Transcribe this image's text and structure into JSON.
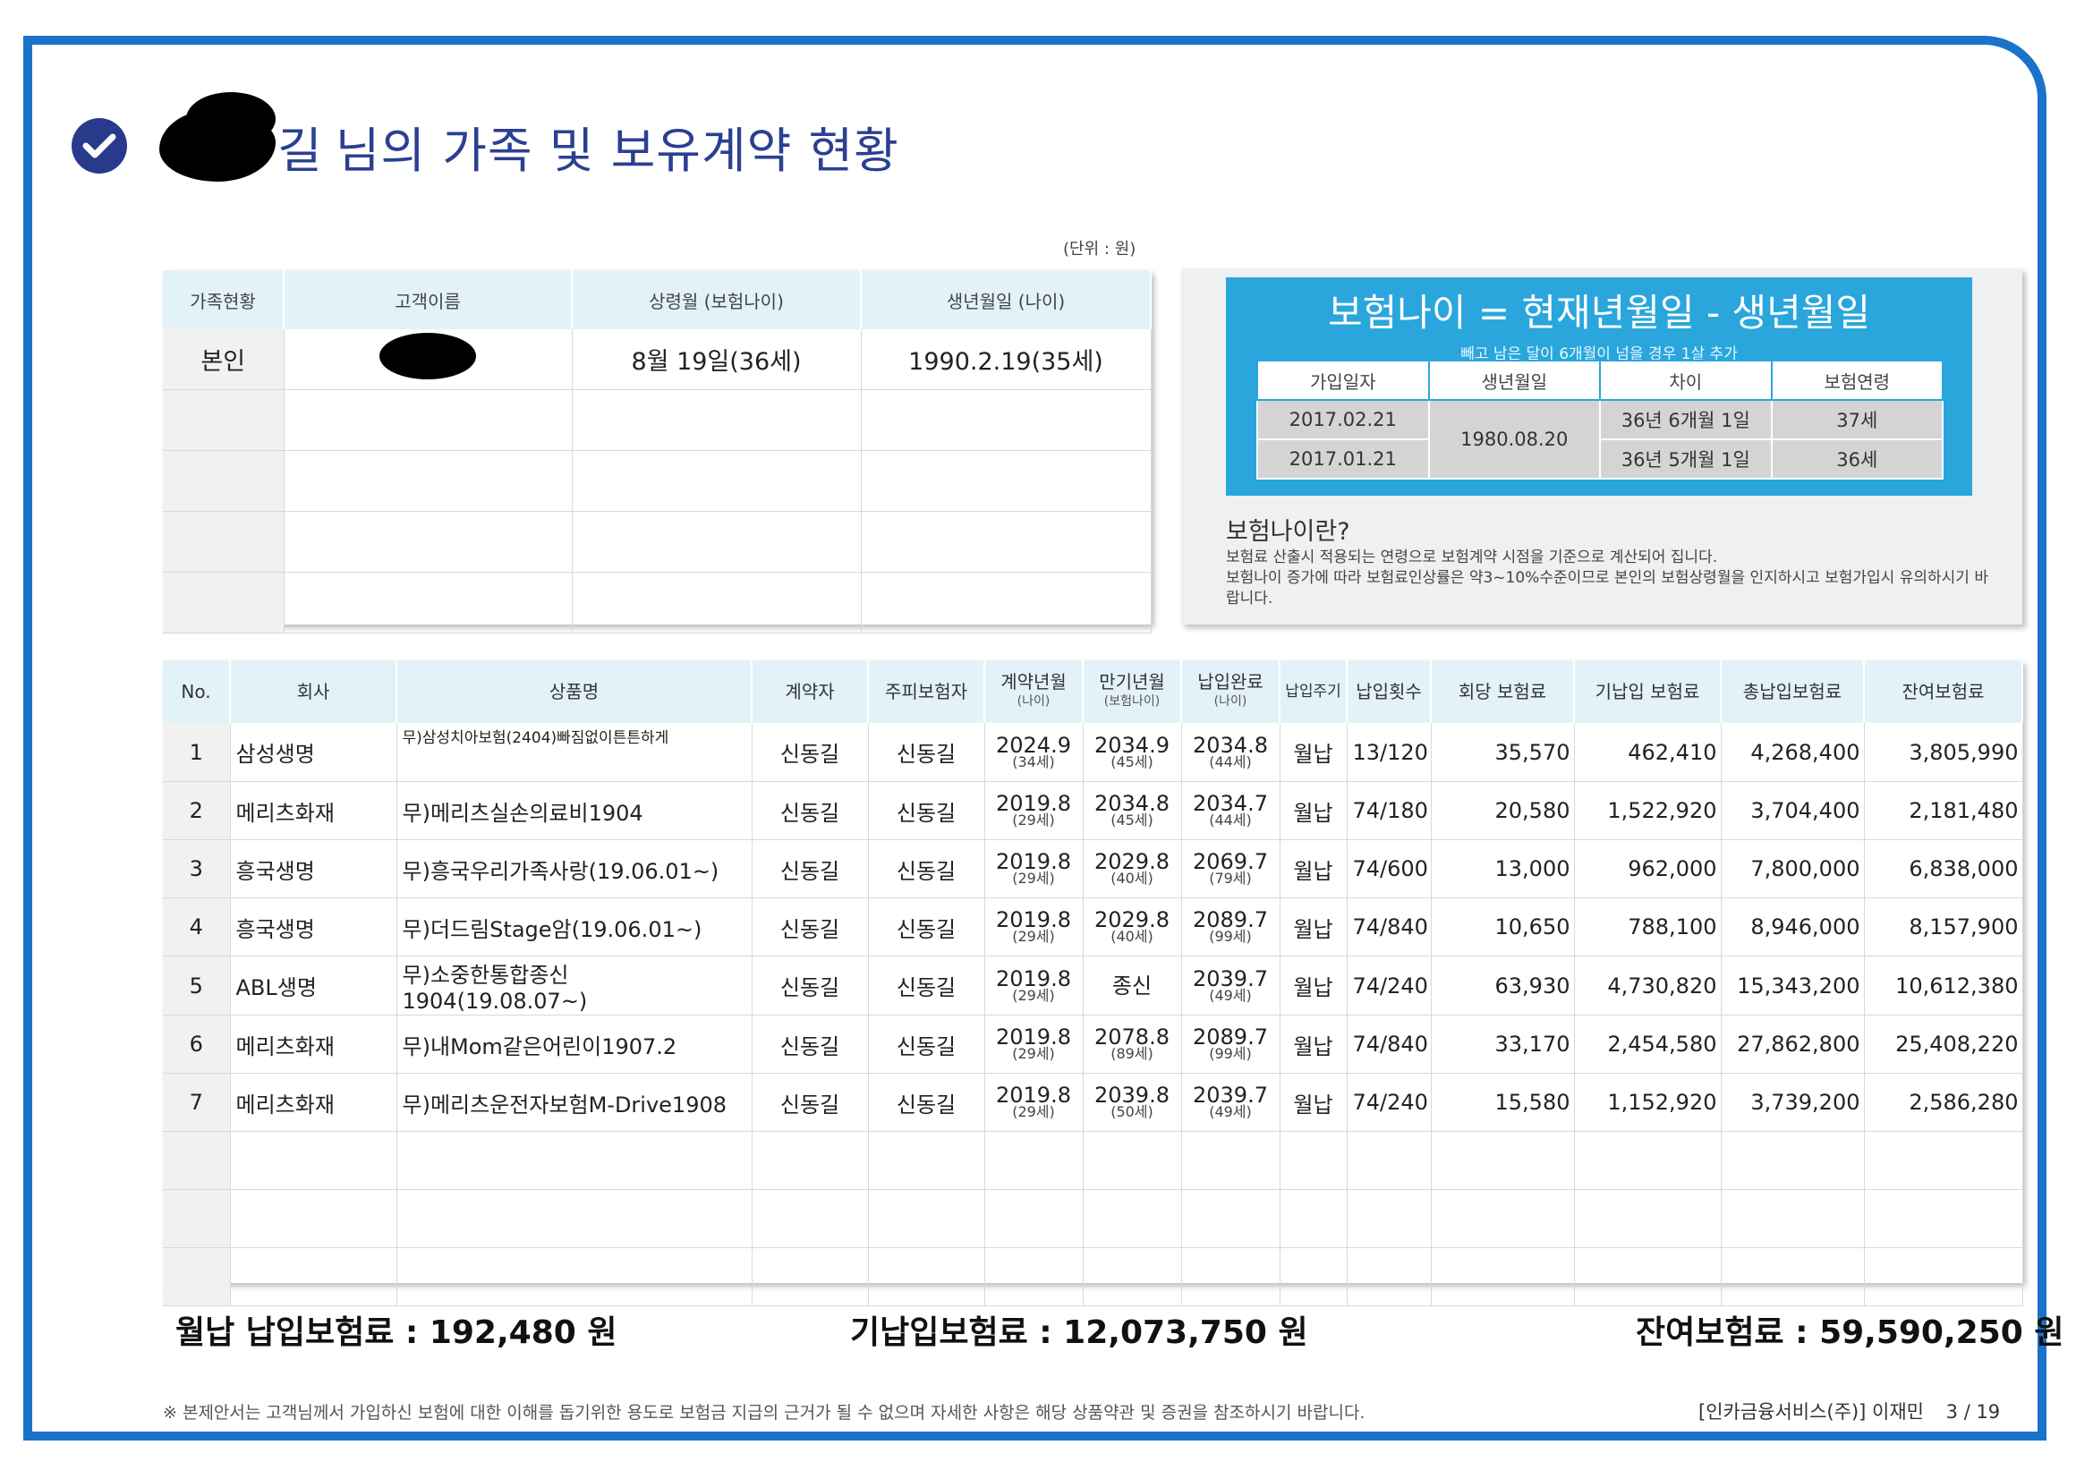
{
  "title": {
    "text": "님의 가족 및 보유계약 현황",
    "name_fragment": "길"
  },
  "unit_label": "(단위 : 원)",
  "family": {
    "headers": [
      "가족현황",
      "고객이름",
      "상령월 (보험나이)",
      "생년월일 (나이)"
    ],
    "rows": [
      {
        "relation": "본인",
        "name": "",
        "age_month": "8월 19일(36세)",
        "birth": "1990.2.19(35세)"
      },
      {
        "relation": "",
        "name": "",
        "age_month": "",
        "birth": ""
      },
      {
        "relation": "",
        "name": "",
        "age_month": "",
        "birth": ""
      },
      {
        "relation": "",
        "name": "",
        "age_month": "",
        "birth": ""
      },
      {
        "relation": "",
        "name": "",
        "age_month": "",
        "birth": ""
      }
    ]
  },
  "age_panel": {
    "formula": "보험나이 = 현재년월일 - 생년월일",
    "note": "빼고 남은 달이 6개월이 넘을 경우 1살 추가",
    "headers": [
      "가입일자",
      "생년월일",
      "차이",
      "보험연령"
    ],
    "rows": [
      {
        "join": "2017.02.21",
        "diff": "36년 6개월 1일",
        "age": "37세"
      },
      {
        "join": "2017.01.21",
        "diff": "36년 5개월 1일",
        "age": "36세"
      }
    ],
    "birth": "1980.08.20",
    "question": "보험나이란?",
    "desc": "보험료 산출시 적용되는 연령으로 보험계약 시점을 기준으로 계산되어 집니다.\n보험나이 증가에 따라 보험료인상률은 약3~10%수준이므로 본인의 보험상령월을 인지하시고 보험가입시 유의하시기 바랍니다."
  },
  "contracts": {
    "headers": {
      "no": "No.",
      "company": "회사",
      "product": "상품명",
      "contractor": "계약자",
      "insured": "주피보험자",
      "contract_date": "계약년월",
      "contract_date_sub": "(나이)",
      "maturity": "만기년월",
      "maturity_sub": "(보험나이)",
      "paid_end": "납입완료",
      "paid_end_sub": "(나이)",
      "cycle": "납입주기",
      "count": "납입횟수",
      "premium": "회당 보험료",
      "paid": "기납입 보험료",
      "total": "총납입보험료",
      "remaining": "잔여보험료"
    },
    "rows": [
      {
        "no": "1",
        "company": "삼성생명",
        "product": "무)삼성치아보험(2404)빠짐없이튼튼하게",
        "contractor": "신동길",
        "insured": "신동길",
        "cd": "2024.9",
        "cd_age": "(34세)",
        "mt": "2034.9",
        "mt_age": "(45세)",
        "pe": "2034.8",
        "pe_age": "(44세)",
        "cycle": "월납",
        "count": "13/120",
        "premium": "35,570",
        "paid": "462,410",
        "total": "4,268,400",
        "remaining": "3,805,990"
      },
      {
        "no": "2",
        "company": "메리츠화재",
        "product": "무)메리츠실손의료비1904",
        "contractor": "신동길",
        "insured": "신동길",
        "cd": "2019.8",
        "cd_age": "(29세)",
        "mt": "2034.8",
        "mt_age": "(45세)",
        "pe": "2034.7",
        "pe_age": "(44세)",
        "cycle": "월납",
        "count": "74/180",
        "premium": "20,580",
        "paid": "1,522,920",
        "total": "3,704,400",
        "remaining": "2,181,480"
      },
      {
        "no": "3",
        "company": "흥국생명",
        "product": "무)흥국우리가족사랑(19.06.01~)",
        "contractor": "신동길",
        "insured": "신동길",
        "cd": "2019.8",
        "cd_age": "(29세)",
        "mt": "2029.8",
        "mt_age": "(40세)",
        "pe": "2069.7",
        "pe_age": "(79세)",
        "cycle": "월납",
        "count": "74/600",
        "premium": "13,000",
        "paid": "962,000",
        "total": "7,800,000",
        "remaining": "6,838,000"
      },
      {
        "no": "4",
        "company": "흥국생명",
        "product": "무)더드림Stage암(19.06.01~)",
        "contractor": "신동길",
        "insured": "신동길",
        "cd": "2019.8",
        "cd_age": "(29세)",
        "mt": "2029.8",
        "mt_age": "(40세)",
        "pe": "2089.7",
        "pe_age": "(99세)",
        "cycle": "월납",
        "count": "74/840",
        "premium": "10,650",
        "paid": "788,100",
        "total": "8,946,000",
        "remaining": "8,157,900"
      },
      {
        "no": "5",
        "company": "ABL생명",
        "product": "무)소중한통합종신1904(19.08.07~)",
        "contractor": "신동길",
        "insured": "신동길",
        "cd": "2019.8",
        "cd_age": "(29세)",
        "mt": "종신",
        "mt_age": "",
        "pe": "2039.7",
        "pe_age": "(49세)",
        "cycle": "월납",
        "count": "74/240",
        "premium": "63,930",
        "paid": "4,730,820",
        "total": "15,343,200",
        "remaining": "10,612,380"
      },
      {
        "no": "6",
        "company": "메리츠화재",
        "product": "무)내Mom같은어린이1907.2",
        "contractor": "신동길",
        "insured": "신동길",
        "cd": "2019.8",
        "cd_age": "(29세)",
        "mt": "2078.8",
        "mt_age": "(89세)",
        "pe": "2089.7",
        "pe_age": "(99세)",
        "cycle": "월납",
        "count": "74/840",
        "premium": "33,170",
        "paid": "2,454,580",
        "total": "27,862,800",
        "remaining": "25,408,220"
      },
      {
        "no": "7",
        "company": "메리츠화재",
        "product": "무)메리츠운전자보험M-Drive1908",
        "contractor": "신동길",
        "insured": "신동길",
        "cd": "2019.8",
        "cd_age": "(29세)",
        "mt": "2039.8",
        "mt_age": "(50세)",
        "pe": "2039.7",
        "pe_age": "(49세)",
        "cycle": "월납",
        "count": "74/240",
        "premium": "15,580",
        "paid": "1,152,920",
        "total": "3,739,200",
        "remaining": "2,586,280"
      }
    ],
    "empty_rows": 3
  },
  "totals": {
    "monthly": "월납 납입보험료 :  192,480 원",
    "paid": "기납입보험료 :  12,073,750 원",
    "remaining": "잔여보험료 :  59,590,250 원"
  },
  "footer": {
    "note": "※ 본제안서는 고객님께서 가입하신 보험에 대한 이해를 돕기위한 용도로 보험금 지급의 근거가 될 수 없으며 자세한 사항은 해당 상품약관 및 증권을 참조하시기 바랍니다.",
    "company": "[인카금융서비스(주)] 이재민",
    "page": "3 / 19"
  },
  "colors": {
    "frame": "#1a73c9",
    "title": "#2b3f92",
    "panel_blue": "#2aa6dd",
    "header_bg": "#e3f2f9"
  }
}
